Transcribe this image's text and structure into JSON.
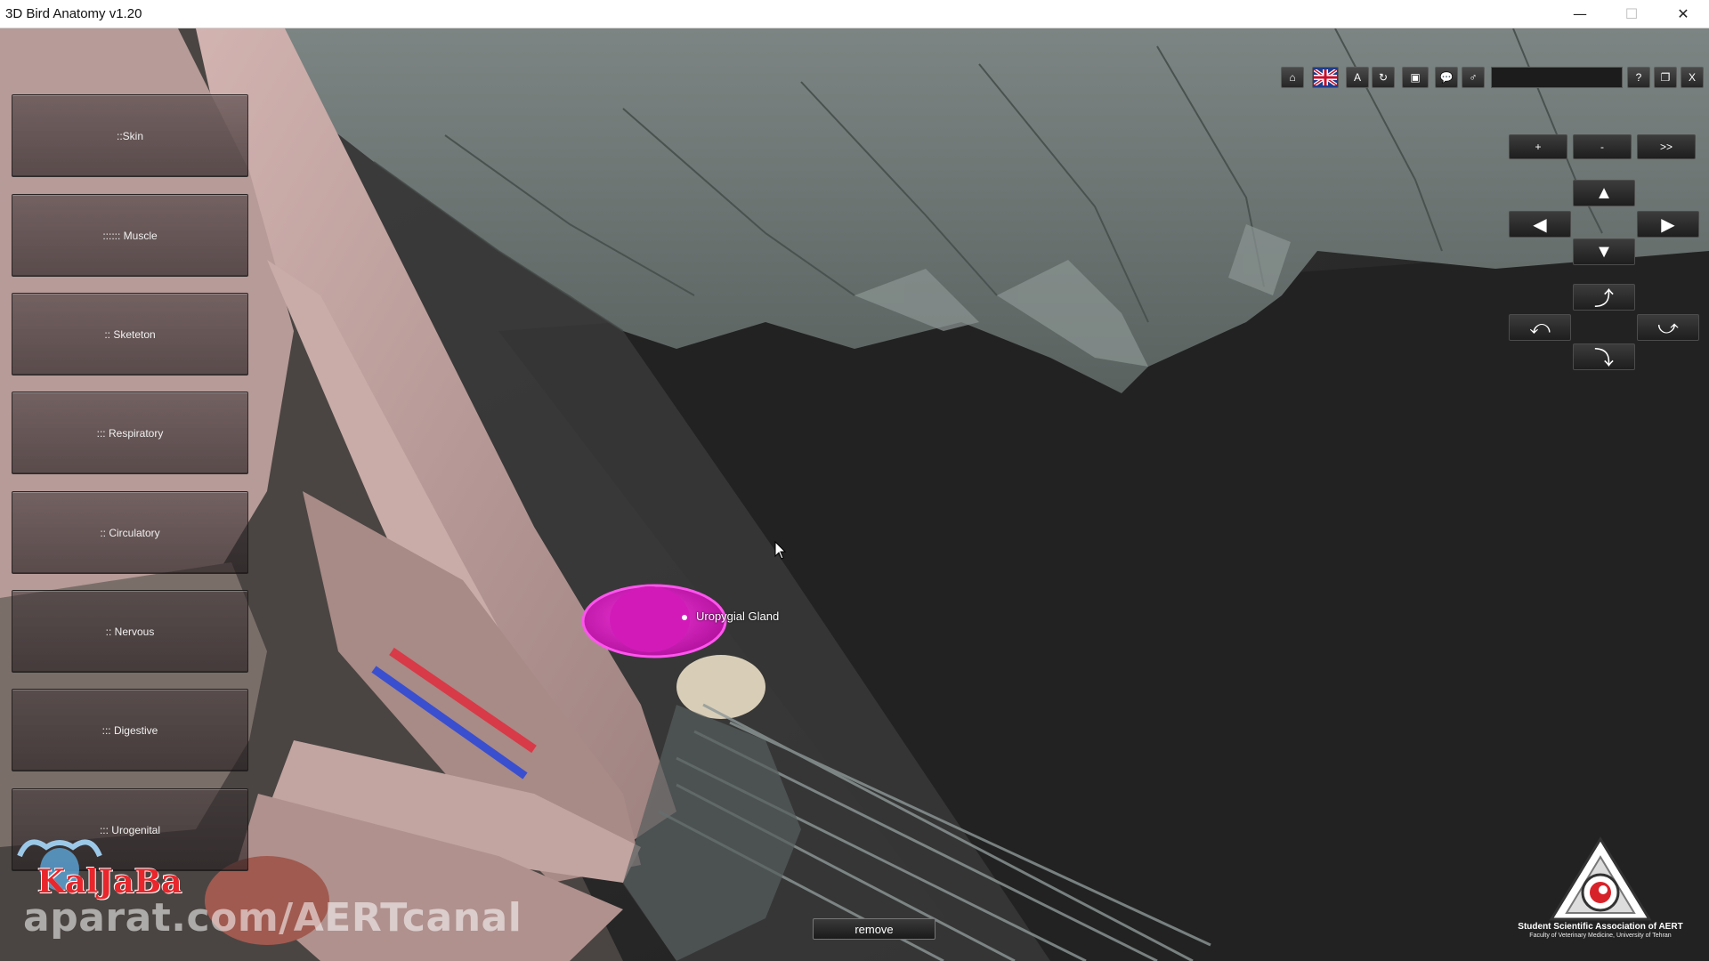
{
  "window": {
    "title": "3D Bird Anatomy v1.20",
    "controls": {
      "minimize": "—",
      "maximize": "☐",
      "close": "✕"
    }
  },
  "systems_menu": [
    {
      "label": "::Skin"
    },
    {
      "label": ":::::: Muscle"
    },
    {
      "label": ":: Sketeton"
    },
    {
      "label": "::: Respiratory"
    },
    {
      "label": ":: Circulatory"
    },
    {
      "label": ":: Nervous"
    },
    {
      "label": "::: Digestive"
    },
    {
      "label": "::: Urogenital"
    }
  ],
  "toolbar": {
    "buttons": [
      {
        "icon": "home-icon",
        "glyph": "⌂"
      },
      {
        "icon": "uk-flag-icon",
        "glyph": ""
      },
      {
        "icon": "font-a-icon",
        "glyph": "A"
      },
      {
        "icon": "reset-rotate-icon",
        "glyph": "↻"
      },
      {
        "icon": "image-icon",
        "glyph": "▣"
      },
      {
        "icon": "speech-bubble-icon",
        "glyph": "💬"
      },
      {
        "icon": "male-female-icon",
        "glyph": "♂"
      }
    ],
    "search": {
      "value": "",
      "placeholder": ""
    },
    "right_buttons": [
      {
        "icon": "help-icon",
        "glyph": "?"
      },
      {
        "icon": "restore-window-icon",
        "glyph": "❐"
      },
      {
        "icon": "close-app-icon",
        "glyph": "X"
      }
    ]
  },
  "navigation": {
    "zoom_in": "+",
    "zoom_out": "-",
    "more": ">>",
    "pan_up": "▲",
    "pan_left": "◀",
    "pan_right": "▶",
    "pan_down": "▼",
    "rotate_up": "⤴",
    "rotate_left": "⤺",
    "rotate_right": "⤻",
    "rotate_down": "⤵"
  },
  "selection": {
    "label": "Uropygial Gland",
    "highlight_color": "#e020c8"
  },
  "remove_button": "remove",
  "watermark": "aparat.com/AERTcanal",
  "logo_left": "KalJaBa",
  "association": {
    "name": "Student Scientific Association of AERT",
    "subtitle": "Faculty of Veterinary Medicine, University of Tehran"
  }
}
